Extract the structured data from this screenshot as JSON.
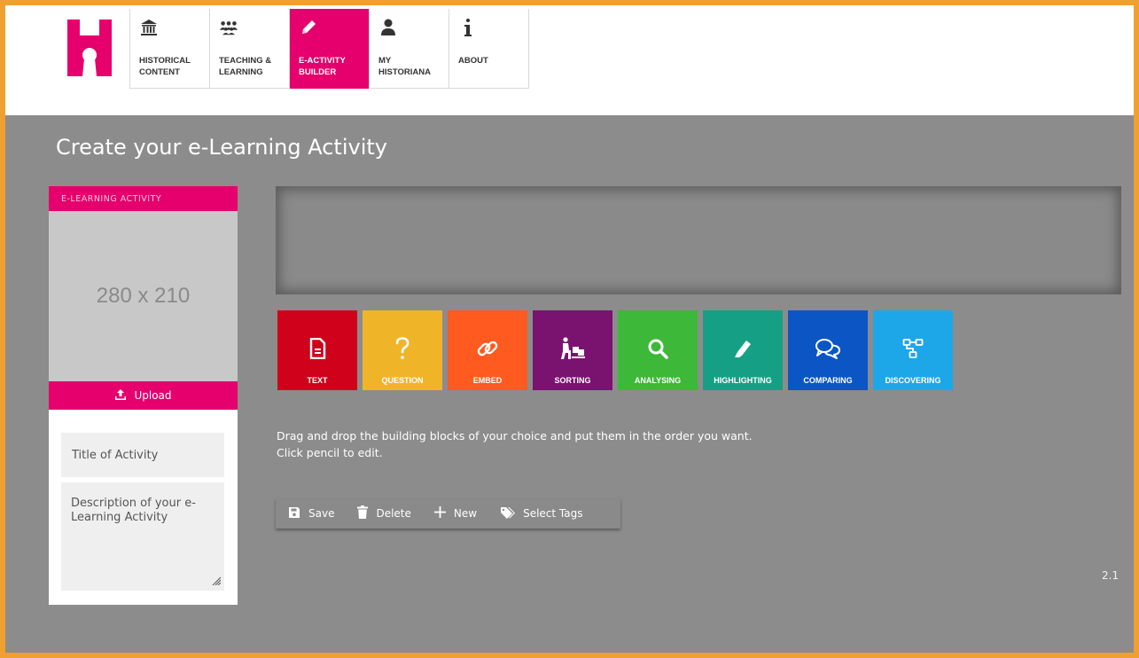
{
  "colors": {
    "brand_pink": "#e5006d",
    "frame_orange": "#f0a030",
    "main_bg": "#8c8c8c"
  },
  "nav": {
    "items": [
      {
        "label": "HISTORICAL\nCONTENT",
        "icon": "museum-icon"
      },
      {
        "label": "TEACHING &\nLEARNING",
        "icon": "group-icon"
      },
      {
        "label": "E-ACTIVITY\nBUILDER",
        "icon": "pencil-icon",
        "active": true
      },
      {
        "label": "MY\nHISTORIANA",
        "icon": "user-icon"
      },
      {
        "label": "ABOUT",
        "icon": "info-icon"
      }
    ]
  },
  "page": {
    "title": "Create your e-Learning Activity",
    "version": "2.1"
  },
  "left_panel": {
    "header": "E-LEARNING ACTIVITY",
    "image_placeholder": "280 x 210",
    "upload_label": "Upload",
    "title_placeholder": "Title of Activity",
    "description_placeholder": "Description of your e-Learning Activity"
  },
  "blocks": [
    {
      "label": "TEXT",
      "icon": "document-icon",
      "color": "#d0021b"
    },
    {
      "label": "QUESTION",
      "icon": "question-icon",
      "color": "#f0b429"
    },
    {
      "label": "EMBED",
      "icon": "link-icon",
      "color": "#ff5a1f"
    },
    {
      "label": "SORTING",
      "icon": "sorting-icon",
      "color": "#7a1270"
    },
    {
      "label": "ANALYSING",
      "icon": "magnifier-icon",
      "color": "#3db838"
    },
    {
      "label": "HIGHLIGHTING",
      "icon": "highlighter-icon",
      "color": "#15a085"
    },
    {
      "label": "COMPARING",
      "icon": "speech-bubbles-icon",
      "color": "#0b56c4"
    },
    {
      "label": "DISCOVERING",
      "icon": "nodes-icon",
      "color": "#1ea7e8"
    }
  ],
  "instructions": {
    "line1": "Drag and drop the building blocks of your choice and put them in the order you want.",
    "line2": "Click pencil to edit."
  },
  "toolbar": {
    "save": "Save",
    "delete": "Delete",
    "new": "New",
    "select_tags": "Select Tags"
  }
}
